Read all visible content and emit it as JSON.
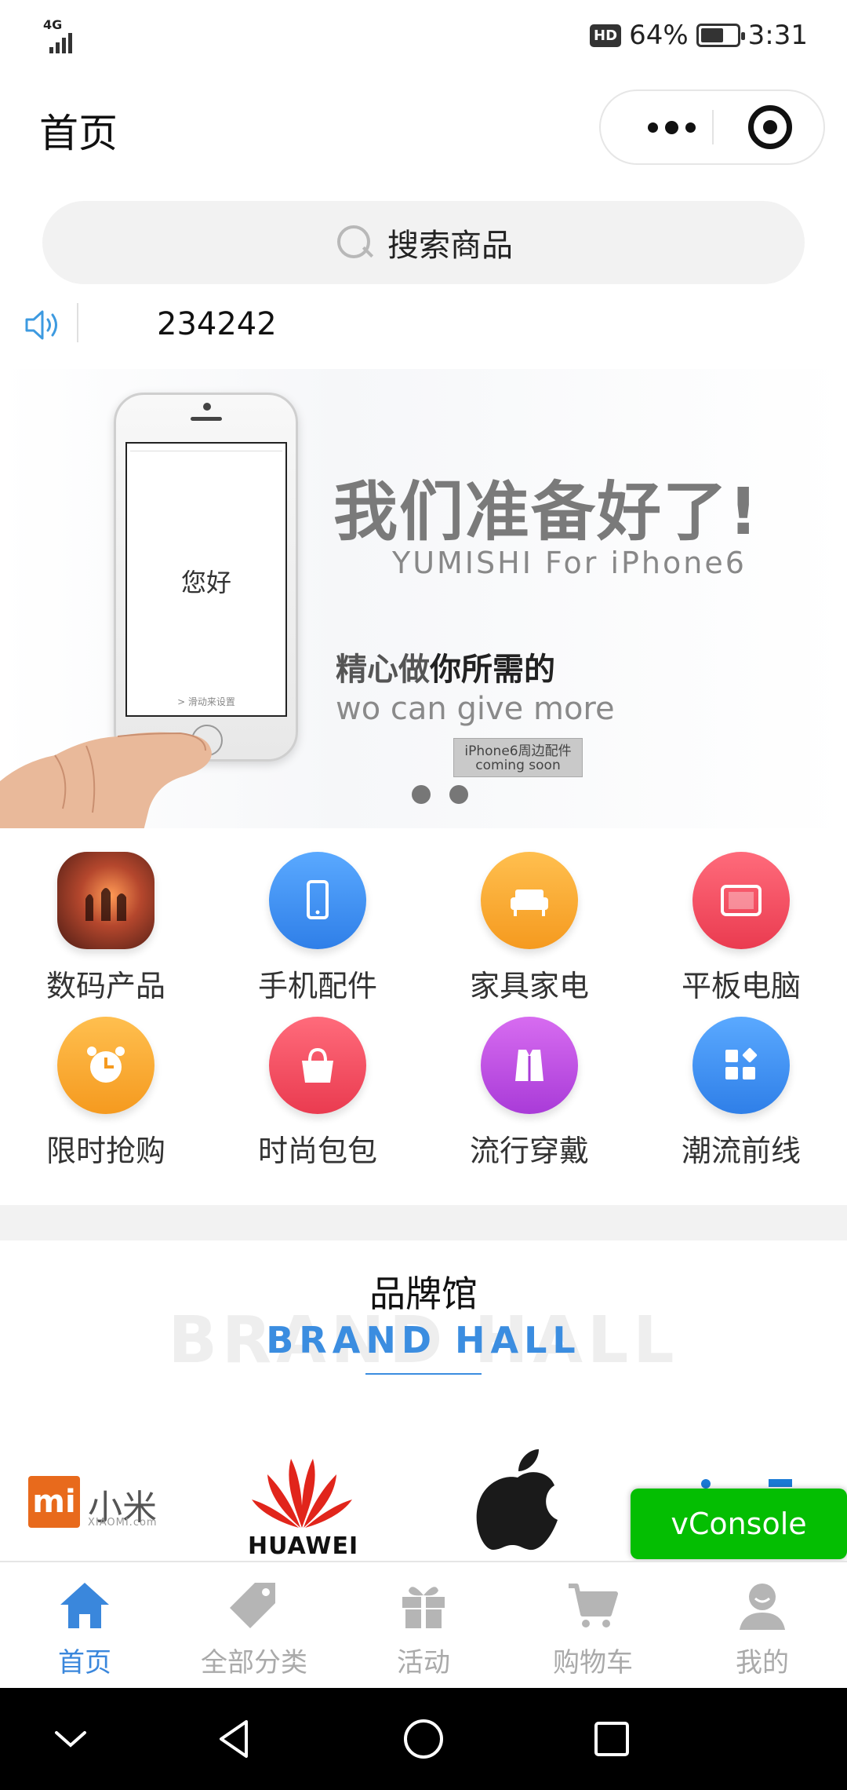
{
  "status_bar": {
    "network": "4G",
    "battery_text": "64%",
    "battery_level": 0.64,
    "hd_badge": "HD",
    "time": "3:31"
  },
  "header": {
    "title": "首页"
  },
  "search": {
    "placeholder": "搜索商品"
  },
  "notice": {
    "text": "234242"
  },
  "banner": {
    "phone_screen_text": "您好",
    "phone_unlock_text": "> 滑动来设置",
    "headline": "我们准备好了!",
    "subheadline": "YUMISHI For iPhone6",
    "tagline_part1": "精心做",
    "tagline_part2": "你所需的",
    "english_line": "wo can give more",
    "badge_line1": "iPhone6周边配件",
    "badge_line2": "coming soon",
    "slide_count": 2
  },
  "categories": [
    {
      "label": "数码产品",
      "icon": "digital-products-icon",
      "color": "#8a3a2a"
    },
    {
      "label": "手机配件",
      "icon": "phone-icon",
      "color": "#3d8ff0"
    },
    {
      "label": "家具家电",
      "icon": "sofa-icon",
      "color": "#f6a52b"
    },
    {
      "label": "平板电脑",
      "icon": "tablet-icon",
      "color": "#f0465a"
    },
    {
      "label": "限时抢购",
      "icon": "alarm-clock-icon",
      "color": "#f6a52b"
    },
    {
      "label": "时尚包包",
      "icon": "handbag-icon",
      "color": "#f0465a"
    },
    {
      "label": "流行穿戴",
      "icon": "clothing-icon",
      "color": "#c24de0"
    },
    {
      "label": "潮流前线",
      "icon": "apps-icon",
      "color": "#3d8ff0"
    }
  ],
  "brand_hall": {
    "title": "品牌馆",
    "subtitle": "BRAND HALL",
    "ghost_text": "BRAND HALL",
    "brands": [
      {
        "name": "小米",
        "logo_text": "mi",
        "sub": "XIAOMI.com"
      },
      {
        "name": "HUAWEI"
      },
      {
        "name": "Apple"
      }
    ]
  },
  "vconsole": {
    "label": "vConsole"
  },
  "tabs": [
    {
      "label": "首页",
      "icon": "home-icon",
      "active": true
    },
    {
      "label": "全部分类",
      "icon": "tag-icon",
      "active": false
    },
    {
      "label": "活动",
      "icon": "gift-icon",
      "active": false
    },
    {
      "label": "购物车",
      "icon": "cart-icon",
      "active": false
    },
    {
      "label": "我的",
      "icon": "user-icon",
      "active": false
    }
  ],
  "colors": {
    "accent": "#3a87dc",
    "inactive": "#aaaaaa",
    "vconsole": "#04be02"
  }
}
